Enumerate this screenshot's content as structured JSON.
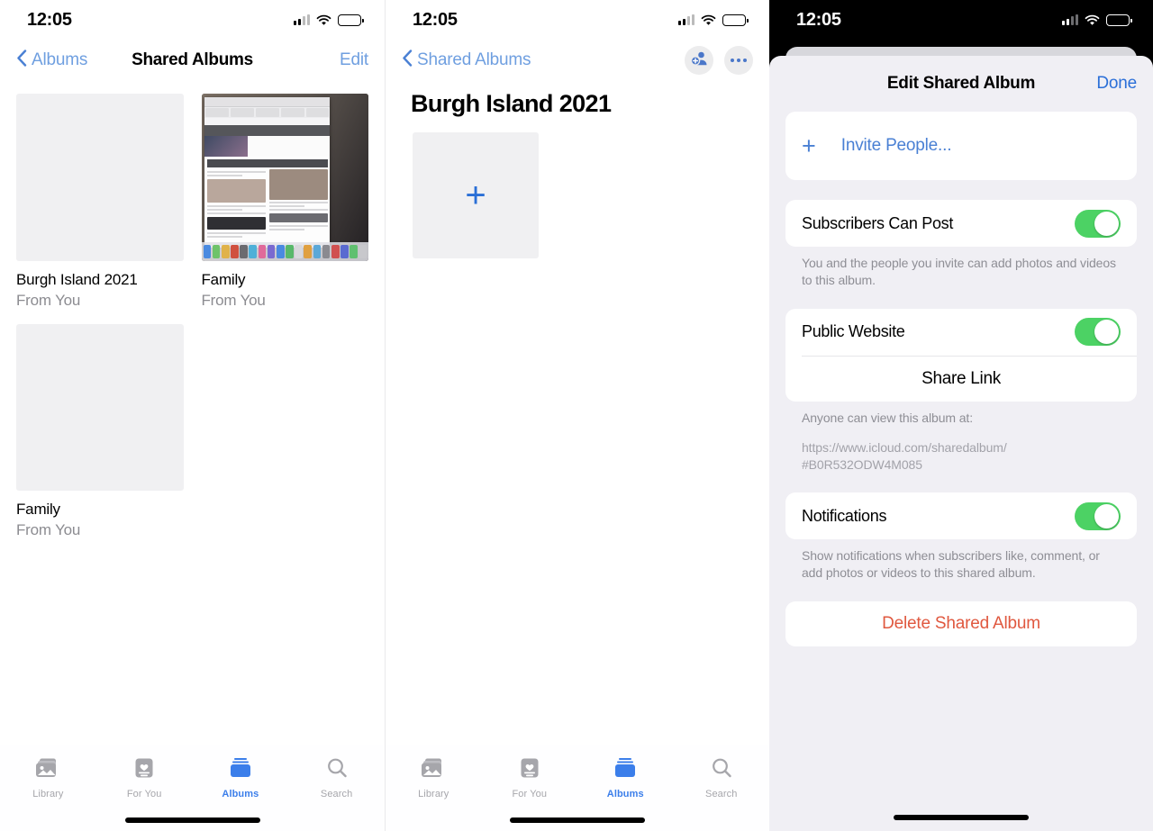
{
  "status_bar": {
    "time": "12:05",
    "signal_icon": "cellular-signal-icon",
    "wifi_icon": "wifi-icon",
    "battery_icon": "battery-icon"
  },
  "accent": {
    "blue": "#3b7eea",
    "link_blue": "#4a80d4",
    "muted_blue": "#6f9fe0",
    "green": "#4cd264",
    "red": "#e0583f"
  },
  "panel1": {
    "nav": {
      "back_label": "Albums",
      "back_icon": "chevron-left-icon",
      "title": "Shared Albums",
      "edit_label": "Edit"
    },
    "albums": [
      {
        "title": "Burgh Island 2021",
        "subtitle": "From You",
        "thumb": "placeholder"
      },
      {
        "title": "Family",
        "subtitle": "From You",
        "thumb": "mac-desktop-screenshot"
      },
      {
        "title": "Family",
        "subtitle": "From You",
        "thumb": "placeholder"
      }
    ]
  },
  "panel2": {
    "nav": {
      "back_label": "Shared Albums",
      "back_icon": "chevron-left-icon"
    },
    "actions": [
      {
        "name": "add-people-icon",
        "label": "Invite People"
      },
      {
        "name": "more-options-icon",
        "label": "More"
      }
    ],
    "title": "Burgh Island 2021",
    "add_tile": {
      "icon": "plus-icon",
      "label": "Add Photos"
    }
  },
  "panel3": {
    "sheet": {
      "title": "Edit Shared Album",
      "done_label": "Done"
    },
    "invite": {
      "icon": "plus-icon",
      "label": "Invite People..."
    },
    "subscribers": {
      "label": "Subscribers Can Post",
      "toggle_state": "on",
      "footnote": "You and the people you invite can add photos and videos to this album."
    },
    "public_website": {
      "label": "Public Website",
      "toggle_state": "on",
      "share_link_label": "Share Link",
      "footnote": "Anyone can view this album at:",
      "url_line1": "https://www.icloud.com/sharedalbum/",
      "url_line2": "#B0R532ODW4M085"
    },
    "notifications": {
      "label": "Notifications",
      "toggle_state": "on",
      "footnote": "Show notifications when subscribers like, comment, or add photos or videos to this shared album."
    },
    "delete": {
      "label": "Delete Shared Album"
    }
  },
  "tabbar": {
    "items": [
      {
        "label": "Library",
        "icon": "photo-stack-icon",
        "active": false
      },
      {
        "label": "For You",
        "icon": "for-you-icon",
        "active": false
      },
      {
        "label": "Albums",
        "icon": "albums-icon",
        "active": true
      },
      {
        "label": "Search",
        "icon": "search-icon",
        "active": false
      }
    ]
  }
}
